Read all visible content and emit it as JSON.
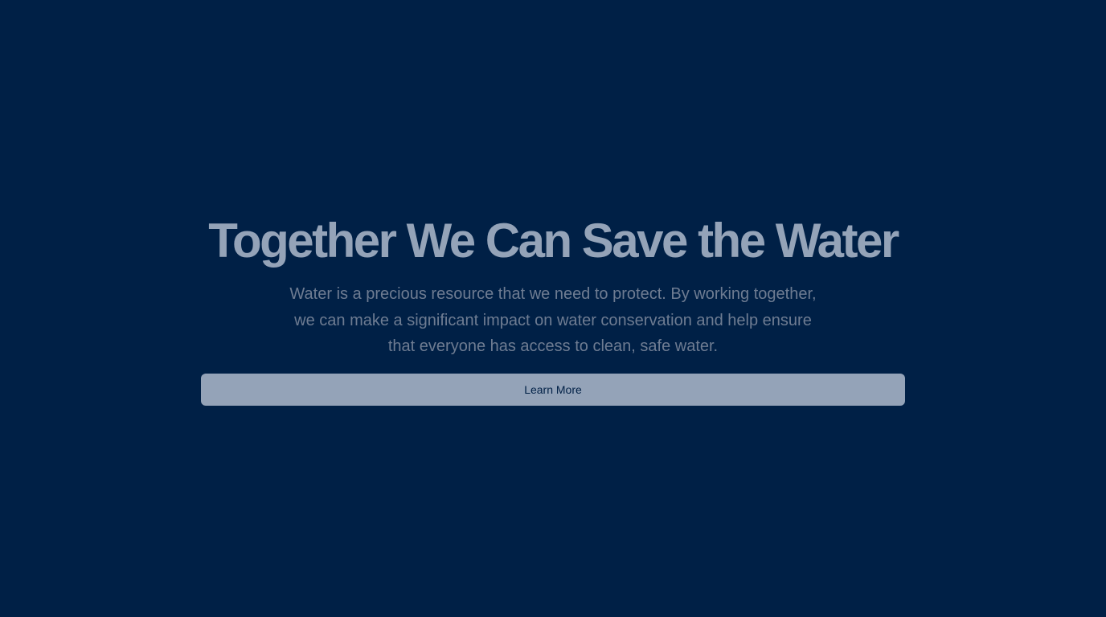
{
  "colors": {
    "background": "#002046",
    "title": "#94a3b8",
    "description": "#6e7c92",
    "button_background": "#94a3b8",
    "button_text": "#002046"
  },
  "hero": {
    "title": "Together We Can Save the Water",
    "description": "Water is a precious resource that we need to protect. By working together, we can make a significant impact on water conservation and help ensure that everyone has access to clean, safe water.",
    "button_label": "Learn More"
  }
}
